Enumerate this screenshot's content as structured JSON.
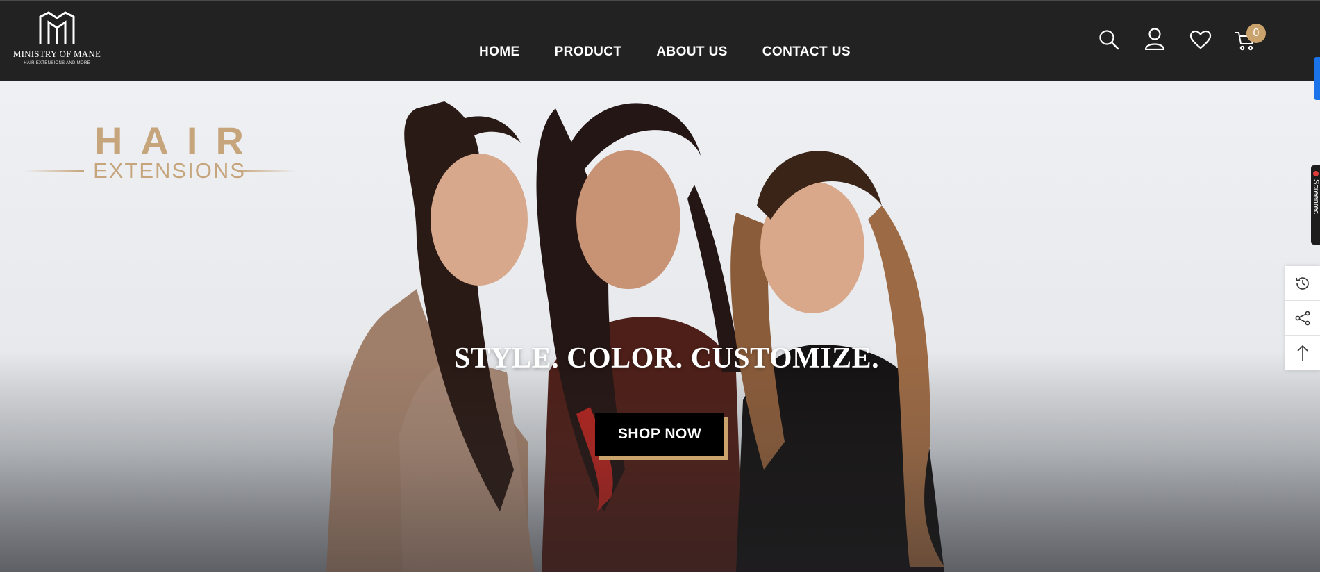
{
  "brand": {
    "name": "MINISTRY OF MANE",
    "tagline": "HAIR EXTENSIONS AND MORE"
  },
  "nav": {
    "items": [
      {
        "label": "HOME"
      },
      {
        "label": "PRODUCT"
      },
      {
        "label": "ABOUT US"
      },
      {
        "label": "CONTACT US"
      }
    ]
  },
  "header_icons": [
    "search-icon",
    "account-icon",
    "wishlist-heart-icon",
    "cart-icon"
  ],
  "cart": {
    "count": "0"
  },
  "hero": {
    "logo_title": "HAIR",
    "logo_subtitle": "EXTENSIONS",
    "heading": "STYLE. COLOR. CUSTOMIZE.",
    "cta_label": "SHOP NOW"
  },
  "side_widgets": {
    "screen_tab_text": "Screenrec",
    "buttons": [
      "recently-viewed-history-icon",
      "share-icon",
      "back-to-top-arrow-icon"
    ]
  },
  "colors": {
    "header_bg": "#222222",
    "accent_gold": "#c9a36b",
    "hero_text_gold": "#c6a57c",
    "cta_bg": "#000000",
    "widget_blue": "#1a73e8"
  }
}
